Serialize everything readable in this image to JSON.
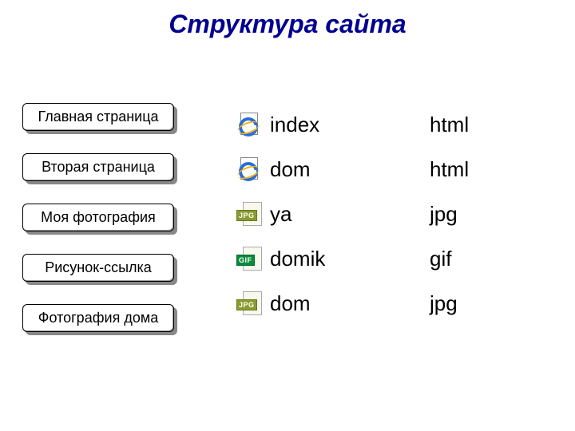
{
  "title": "Структура сайта",
  "buttons": [
    {
      "label": "Главная страница"
    },
    {
      "label": "Вторая страница"
    },
    {
      "label": "Моя фотография"
    },
    {
      "label": "Рисунок-ссылка"
    },
    {
      "label": "Фотография дома"
    }
  ],
  "files": [
    {
      "icon": "ie",
      "icon_badge": "",
      "name": "index",
      "ext": "html"
    },
    {
      "icon": "ie",
      "icon_badge": "",
      "name": "dom",
      "ext": "html"
    },
    {
      "icon": "jpg",
      "icon_badge": "JPG",
      "name": "ya",
      "ext": "jpg"
    },
    {
      "icon": "gif",
      "icon_badge": "GIF",
      "name": "domik",
      "ext": "gif"
    },
    {
      "icon": "jpg",
      "icon_badge": "JPG",
      "name": "dom",
      "ext": "jpg"
    }
  ]
}
